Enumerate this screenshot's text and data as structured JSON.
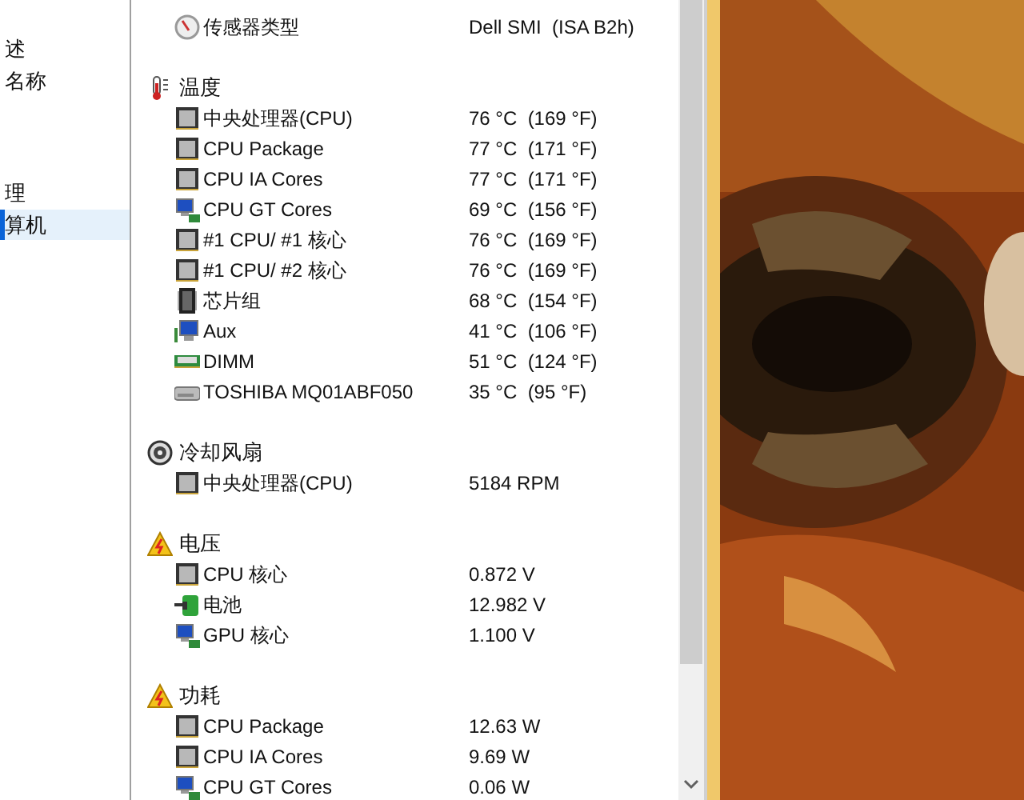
{
  "sidebar": {
    "items": [
      {
        "label": "述",
        "selected": false
      },
      {
        "label": "名称",
        "selected": false
      },
      {
        "label": "理",
        "selected": false
      },
      {
        "label": "算机",
        "selected": true
      }
    ]
  },
  "sections": [
    {
      "items": [
        {
          "kind": "gauge",
          "label": "传感器类型",
          "value": "Dell SMI  (ISA B2h)"
        }
      ]
    },
    {
      "kind": "thermometer",
      "title": "温度",
      "items": [
        {
          "kind": "cpu",
          "label": "中央处理器(CPU)",
          "value": "76 °C  (169 °F)"
        },
        {
          "kind": "cpu",
          "label": "CPU Package",
          "value": "77 °C  (171 °F)"
        },
        {
          "kind": "cpu",
          "label": "CPU IA Cores",
          "value": "77 °C  (171 °F)"
        },
        {
          "kind": "gpu",
          "label": "CPU GT Cores",
          "value": "69 °C  (156 °F)"
        },
        {
          "kind": "cpu",
          "label": "#1 CPU/ #1 核心",
          "value": "76 °C  (169 °F)"
        },
        {
          "kind": "cpu",
          "label": "#1 CPU/ #2 核心",
          "value": "76 °C  (169 °F)"
        },
        {
          "kind": "chipset",
          "label": "芯片组",
          "value": "68 °C  (154 °F)"
        },
        {
          "kind": "monitor",
          "label": "Aux",
          "value": "41 °C  (106 °F)"
        },
        {
          "kind": "memory",
          "label": "DIMM",
          "value": "51 °C  (124 °F)"
        },
        {
          "kind": "drive",
          "label": "TOSHIBA MQ01ABF050",
          "value": "35 °C  (95 °F)"
        }
      ]
    },
    {
      "kind": "fan",
      "title": "冷却风扇",
      "items": [
        {
          "kind": "cpu",
          "label": "中央处理器(CPU)",
          "value": "5184 RPM"
        }
      ]
    },
    {
      "kind": "warning",
      "title": "电压",
      "items": [
        {
          "kind": "cpu",
          "label": "CPU 核心",
          "value": "0.872 V"
        },
        {
          "kind": "battery",
          "label": "电池",
          "value": "12.982 V"
        },
        {
          "kind": "gpu",
          "label": "GPU 核心",
          "value": "1.100 V"
        }
      ]
    },
    {
      "kind": "warning",
      "title": "功耗",
      "items": [
        {
          "kind": "cpu",
          "label": "CPU Package",
          "value": "12.63 W"
        },
        {
          "kind": "cpu",
          "label": "CPU IA Cores",
          "value": "9.69 W"
        },
        {
          "kind": "gpu",
          "label": "CPU GT Cores",
          "value": "0.06 W"
        }
      ]
    }
  ]
}
